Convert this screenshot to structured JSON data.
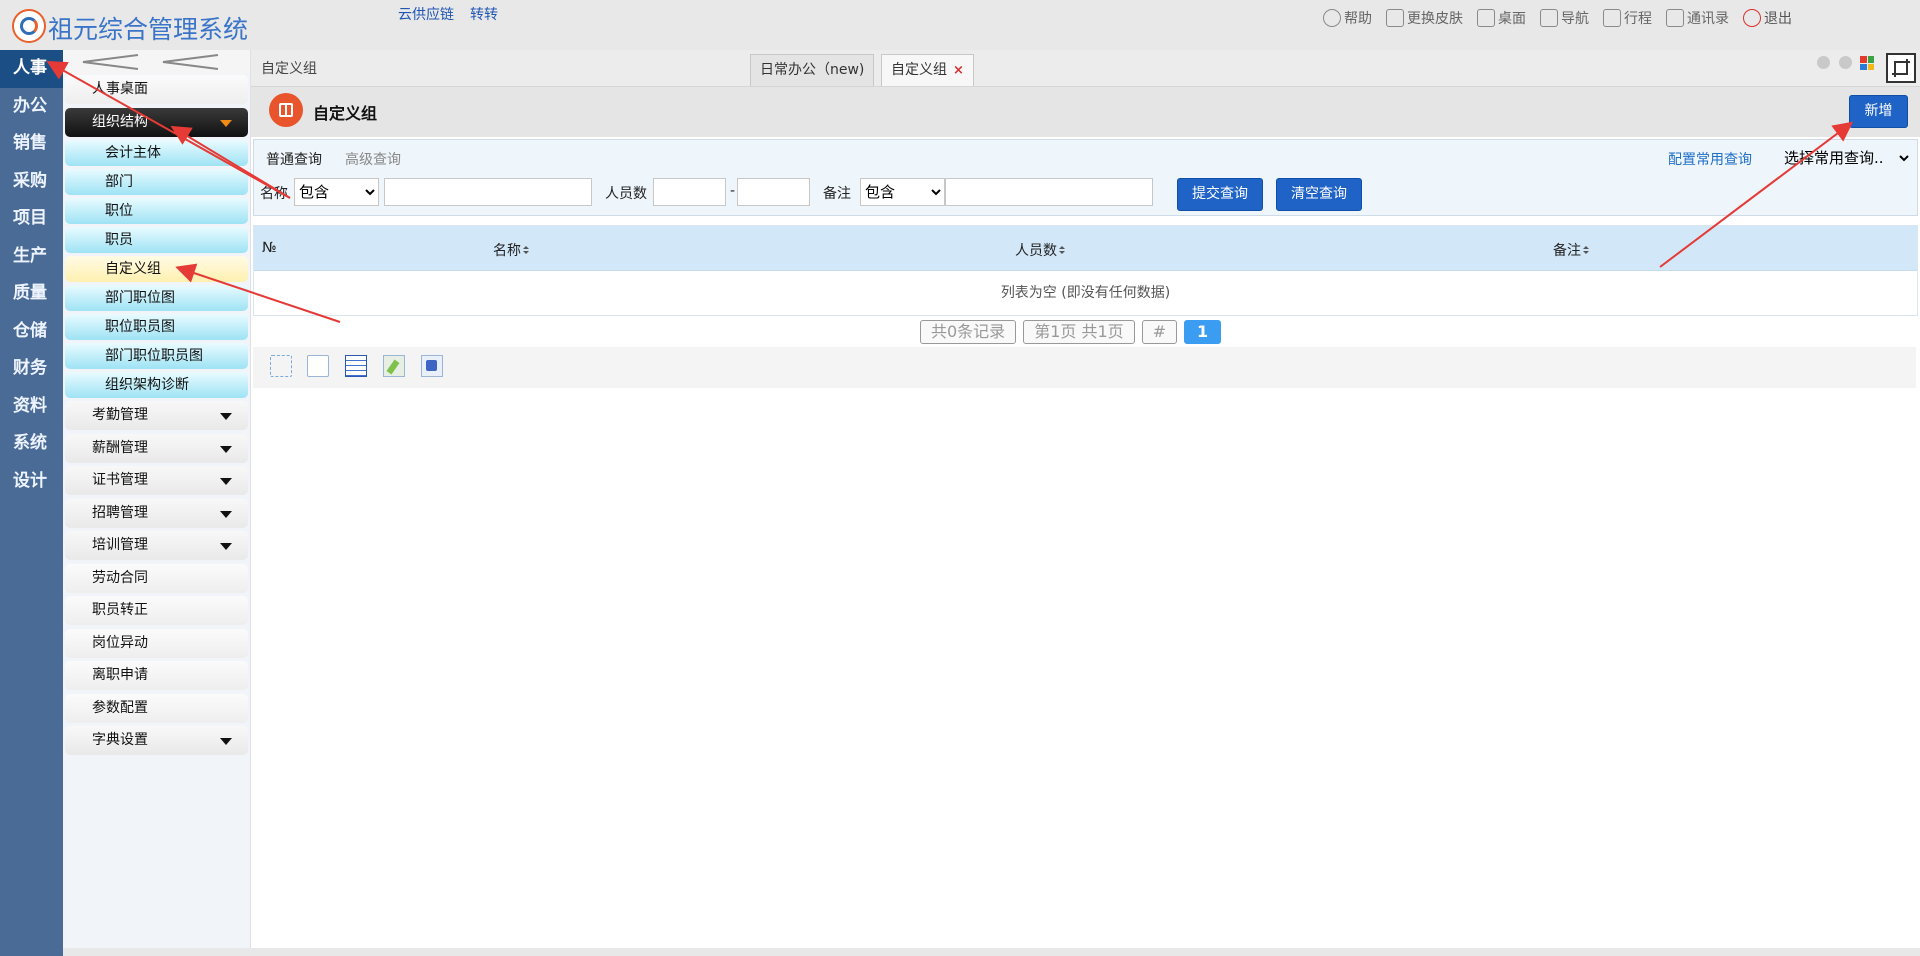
{
  "app": {
    "title": "祖元综合管理系统",
    "top_links": [
      "云供应链",
      "转转"
    ],
    "top_menu": [
      {
        "label": "帮助",
        "icon": "help-icon"
      },
      {
        "label": "更换皮肤",
        "icon": "shirt-icon"
      },
      {
        "label": "桌面",
        "icon": "home-icon"
      },
      {
        "label": "导航",
        "icon": "grid-icon"
      },
      {
        "label": "行程",
        "icon": "calendar-icon"
      },
      {
        "label": "通讯录",
        "icon": "contacts-icon"
      },
      {
        "label": "退出",
        "icon": "power-icon"
      }
    ]
  },
  "leftnav": [
    "人事",
    "办公",
    "销售",
    "采购",
    "项目",
    "生产",
    "质量",
    "仓储",
    "财务",
    "资料",
    "系统",
    "设计"
  ],
  "sidebar": {
    "desk": "人事桌面",
    "org": "组织结构",
    "org_items": [
      "会计主体",
      "部门",
      "职位",
      "职员",
      "自定义组",
      "部门职位图",
      "职位职员图",
      "部门职位职员图",
      "组织架构诊断"
    ],
    "groups": [
      {
        "label": "考勤管理",
        "expandable": true
      },
      {
        "label": "薪酬管理",
        "expandable": true
      },
      {
        "label": "证书管理",
        "expandable": true
      },
      {
        "label": "招聘管理",
        "expandable": true
      },
      {
        "label": "培训管理",
        "expandable": true
      },
      {
        "label": "劳动合同",
        "expandable": false
      },
      {
        "label": "职员转正",
        "expandable": false
      },
      {
        "label": "岗位异动",
        "expandable": false
      },
      {
        "label": "离职申请",
        "expandable": false
      },
      {
        "label": "参数配置",
        "expandable": false
      },
      {
        "label": "字典设置",
        "expandable": true
      }
    ]
  },
  "breadcrumb": "自定义组",
  "tabs": [
    {
      "label": "日常办公（new)"
    },
    {
      "label": "自定义组",
      "active": true,
      "close": "×"
    }
  ],
  "page": {
    "title": "自定义组",
    "add_button": "新增"
  },
  "query": {
    "normal": "普通查询",
    "advanced": "高级查询",
    "config": "配置常用查询",
    "common_select": "选择常用查询..",
    "name_label": "名称",
    "name_op": "包含",
    "count_label": "人员数",
    "dash": "-",
    "remark_label": "备注",
    "remark_op": "包含",
    "submit": "提交查询",
    "clear": "清空查询"
  },
  "grid": {
    "columns": [
      "№",
      "名称",
      "人员数",
      "备注"
    ],
    "empty": "列表为空 (即没有任何数据)"
  },
  "pagination": {
    "total": "共0条记录",
    "pages": "第1页 共1页",
    "hash": "#",
    "current": "1"
  },
  "colors": {
    "leftnav_bg": "#4a6b95",
    "accent_blue": "#1f63c6",
    "page_icon": "#e8542b",
    "annotation_arrow": "#e53a35"
  }
}
